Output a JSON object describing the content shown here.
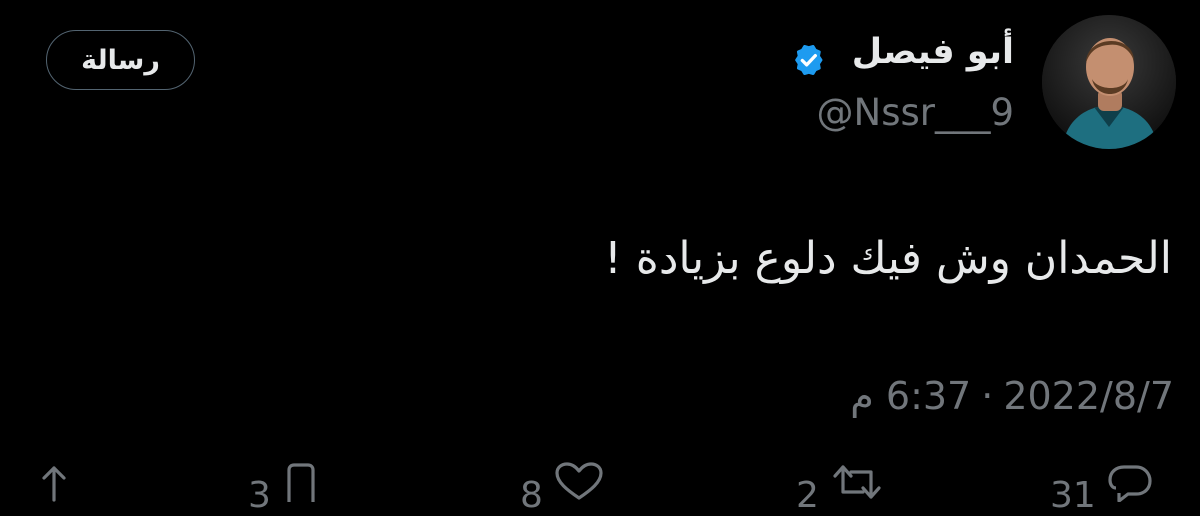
{
  "profile": {
    "display_name": "أبو فيصل",
    "handle": "@Nssr___9",
    "verified": true
  },
  "header": {
    "message_button_label": "رسالة"
  },
  "tweet": {
    "text": "الحمدان وش فيك دلوع بزيادة !",
    "date": "2022/8/7",
    "separator": "·",
    "time": "6:37 م"
  },
  "actions": {
    "replies": "31",
    "retweets": "2",
    "likes": "8",
    "bookmarks": "3"
  },
  "colors": {
    "background": "#000000",
    "text_primary": "#e7e9ea",
    "text_secondary": "#71767b",
    "verified_blue": "#1d9bf0"
  }
}
